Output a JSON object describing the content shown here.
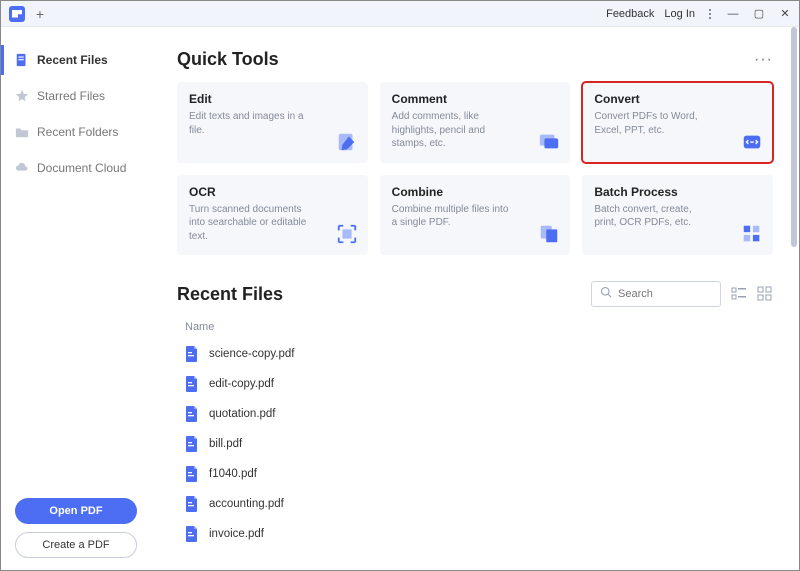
{
  "titlebar": {
    "feedback": "Feedback",
    "login": "Log In"
  },
  "sidebar": {
    "items": [
      {
        "label": "Recent Files",
        "icon": "recent-files-icon",
        "active": true
      },
      {
        "label": "Starred Files",
        "icon": "star-icon",
        "active": false
      },
      {
        "label": "Recent Folders",
        "icon": "folder-icon",
        "active": false
      },
      {
        "label": "Document Cloud",
        "icon": "cloud-icon",
        "active": false
      }
    ],
    "open_pdf": "Open PDF",
    "create_pdf": "Create a PDF"
  },
  "quick_tools": {
    "heading": "Quick Tools",
    "cards": [
      {
        "title": "Edit",
        "desc": "Edit texts and images in a file.",
        "icon": "edit-icon",
        "highlight": false
      },
      {
        "title": "Comment",
        "desc": "Add comments, like highlights, pencil and stamps, etc.",
        "icon": "comment-icon",
        "highlight": false
      },
      {
        "title": "Convert",
        "desc": "Convert PDFs to Word, Excel, PPT, etc.",
        "icon": "convert-icon",
        "highlight": true
      },
      {
        "title": "OCR",
        "desc": "Turn scanned documents into searchable or editable text.",
        "icon": "ocr-icon",
        "highlight": false
      },
      {
        "title": "Combine",
        "desc": "Combine multiple files into a single PDF.",
        "icon": "combine-icon",
        "highlight": false
      },
      {
        "title": "Batch Process",
        "desc": "Batch convert, create, print, OCR PDFs, etc.",
        "icon": "batch-icon",
        "highlight": false
      }
    ]
  },
  "recent": {
    "heading": "Recent Files",
    "search_placeholder": "Search",
    "col_name": "Name",
    "files": [
      {
        "name": "science-copy.pdf"
      },
      {
        "name": "edit-copy.pdf"
      },
      {
        "name": "quotation.pdf"
      },
      {
        "name": "bill.pdf"
      },
      {
        "name": "f1040.pdf"
      },
      {
        "name": "accounting.pdf"
      },
      {
        "name": "invoice.pdf"
      }
    ]
  },
  "colors": {
    "accent": "#4d6ef2",
    "highlight_border": "#d92424"
  }
}
